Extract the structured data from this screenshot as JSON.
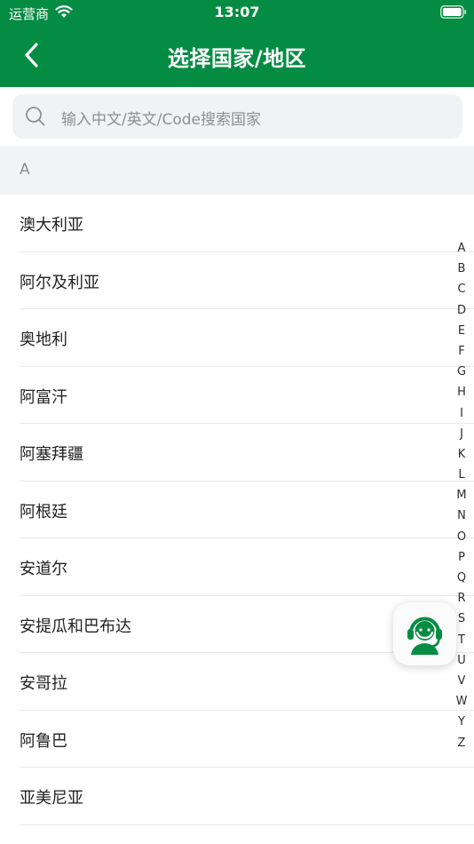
{
  "status": {
    "carrier": "运营商",
    "time": "13:07"
  },
  "nav": {
    "title": "选择国家/地区"
  },
  "search": {
    "placeholder": "输入中文/英文/Code搜索国家"
  },
  "section": {
    "letter": "A"
  },
  "countries": [
    "澳大利亚",
    "阿尔及利亚",
    "奥地利",
    "阿富汗",
    "阿塞拜疆",
    "阿根廷",
    "安道尔",
    "安提瓜和巴布达",
    "安哥拉",
    "阿鲁巴",
    "亚美尼亚"
  ],
  "index_letters": [
    "A",
    "B",
    "C",
    "D",
    "E",
    "F",
    "G",
    "H",
    "I",
    "J",
    "K",
    "L",
    "M",
    "N",
    "O",
    "P",
    "Q",
    "R",
    "S",
    "T",
    "U",
    "V",
    "W",
    "Y",
    "Z"
  ],
  "colors": {
    "brand": "#058c43",
    "section_bg": "#f2f3f5"
  },
  "icons": {
    "fab": "customer-service-icon",
    "back": "chevron-left-icon",
    "search": "search-icon"
  }
}
